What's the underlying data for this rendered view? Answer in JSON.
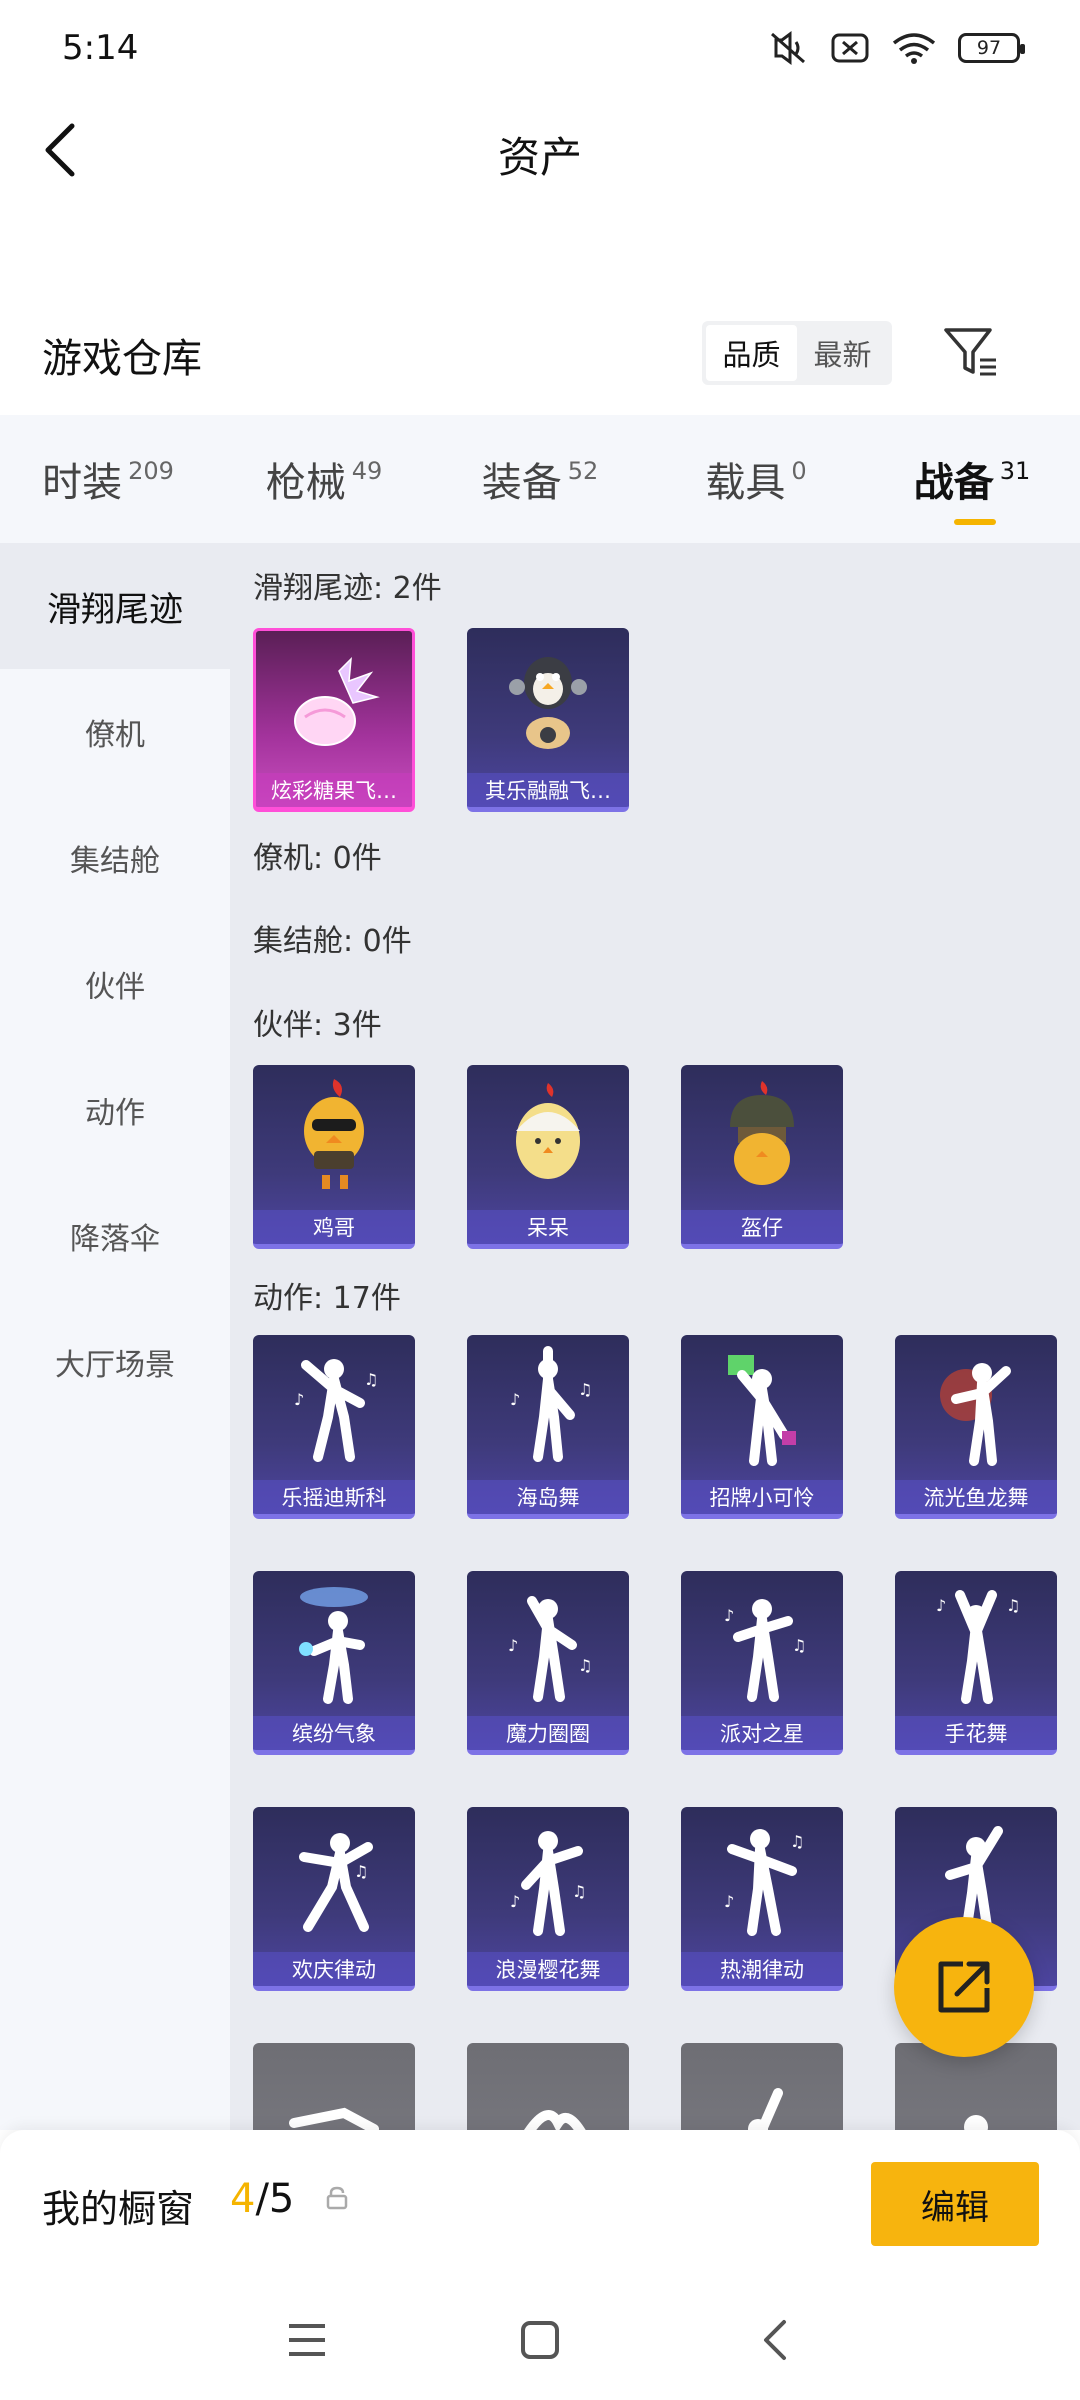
{
  "status_bar": {
    "time": "5:14",
    "battery": "97"
  },
  "header": {
    "title": "资产"
  },
  "warehouse": {
    "title": "游戏仓库",
    "sort_options": [
      "品质",
      "最新"
    ]
  },
  "category_tabs": [
    {
      "label": "时装",
      "count": "209"
    },
    {
      "label": "枪械",
      "count": "49"
    },
    {
      "label": "装备",
      "count": "52"
    },
    {
      "label": "载具",
      "count": "0"
    },
    {
      "label": "战备",
      "count": "31"
    }
  ],
  "side_nav": [
    "滑翔尾迹",
    "僚机",
    "集结舱",
    "伙伴",
    "动作",
    "降落伞",
    "大厅场景"
  ],
  "sections": {
    "trail": {
      "label": "滑翔尾迹: 2件",
      "items": [
        "炫彩糖果飞…",
        "其乐融融飞…"
      ]
    },
    "wingman": {
      "label": "僚机: 0件"
    },
    "pod": {
      "label": "集结舱: 0件"
    },
    "partner": {
      "label": "伙伴: 3件",
      "items": [
        "鸡哥",
        "呆呆",
        "盔仔"
      ]
    },
    "emote": {
      "label": "动作: 17件",
      "items": [
        "乐摇迪斯科",
        "海岛舞",
        "招牌小可怜",
        "流光鱼龙舞",
        "缤纷气象",
        "魔力圈圈",
        "派对之星",
        "手花舞",
        "欢庆律动",
        "浪漫樱花舞",
        "热潮律动"
      ]
    }
  },
  "showcase": {
    "title": "我的橱窗",
    "current": "4",
    "total": "/5",
    "edit_label": "编辑"
  },
  "colors": {
    "accent": "#f7b40e",
    "card_purple": "#3e3a7a",
    "card_pink": "#c94ebf"
  },
  "icons": [
    "back-arrow-icon",
    "filter-icon",
    "share-icon",
    "lock-icon",
    "menu-icon",
    "home-icon",
    "back-icon"
  ]
}
